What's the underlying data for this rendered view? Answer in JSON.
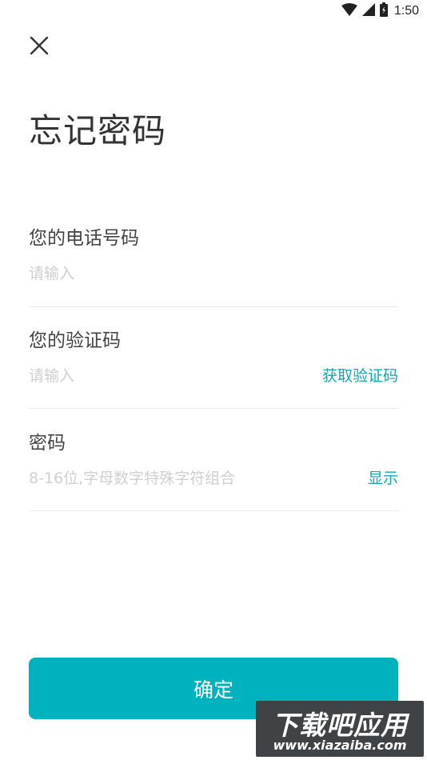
{
  "status_bar": {
    "time": "1:50",
    "icons": [
      "wifi-icon",
      "cell-signal-icon",
      "battery-icon"
    ]
  },
  "header": {
    "close_icon": "close-icon"
  },
  "page": {
    "title": "忘记密码"
  },
  "fields": {
    "phone": {
      "label": "您的电话号码",
      "placeholder": "请输入",
      "value": ""
    },
    "code": {
      "label": "您的验证码",
      "placeholder": "请输入",
      "value": "",
      "action_label": "获取验证码"
    },
    "password": {
      "label": "密码",
      "placeholder": "8-16位,字母数字特殊字符组合",
      "value": "",
      "action_label": "显示"
    }
  },
  "footer": {
    "confirm_label": "确定"
  },
  "watermark": {
    "title": "下载吧应用",
    "url": "www.xiazaiba.com"
  },
  "colors": {
    "accent": "#00b2bd",
    "link": "#12a7b1",
    "placeholder": "#cfcfcf",
    "divider": "#ebebeb"
  }
}
